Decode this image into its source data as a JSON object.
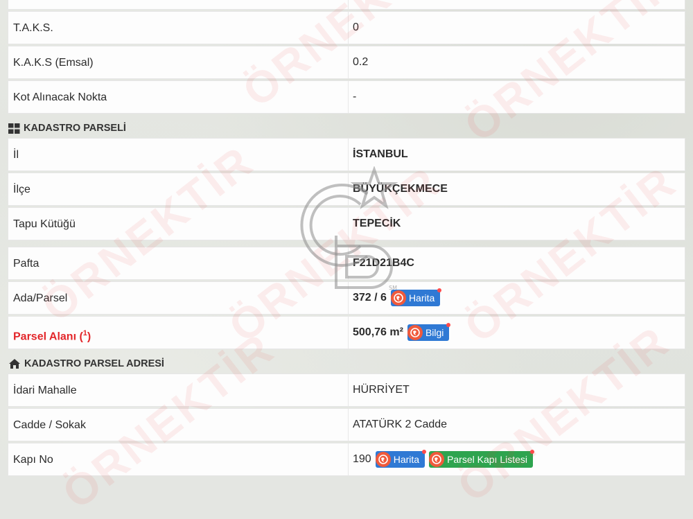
{
  "top_row": {
    "label": "",
    "value": ""
  },
  "imar_rows": [
    {
      "label": "T.A.K.S.",
      "value": "0"
    },
    {
      "label": "K.A.K.S (Emsal)",
      "value": "0.2"
    },
    {
      "label": "Kot Alınacak Nokta",
      "value": "-"
    }
  ],
  "kadastro_section": {
    "title": "KADASTRO PARSELİ",
    "icon": "grid-icon"
  },
  "kadastro_rows": [
    {
      "label": "İl",
      "value": "İSTANBUL"
    },
    {
      "label": "İlçe",
      "value": "BÜYÜKÇEKMECE"
    },
    {
      "label": "Tapu Kütüğü",
      "value": "TEPECİK"
    },
    {
      "label": "Pafta",
      "value": "F21D21B4C"
    },
    {
      "label": "Ada/Parsel",
      "value": "372 / 6",
      "button": "Harita"
    },
    {
      "label": "Parsel Alanı (",
      "label_sup": "1",
      "label_end": ")",
      "value": "500,76 m²",
      "button": "Bilgi"
    }
  ],
  "adres_section": {
    "title": "KADASTRO PARSEL ADRESİ",
    "icon": "home-icon"
  },
  "adres_rows": [
    {
      "label": "İdari Mahalle",
      "value": "HÜRRİYET"
    },
    {
      "label": "Cadde / Sokak",
      "value": "ATATÜRK 2 Cadde"
    },
    {
      "label": "Kapı No",
      "value": "190",
      "button": "Harita",
      "button2": "Parsel Kapı Listesi"
    }
  ],
  "watermark": "ÖRNEKTİR",
  "colors": {
    "accent_red": "#e3262a",
    "badge_blue": "#2f79d4",
    "badge_green": "#2ea44f",
    "badge_icon": "#f05a3c"
  }
}
